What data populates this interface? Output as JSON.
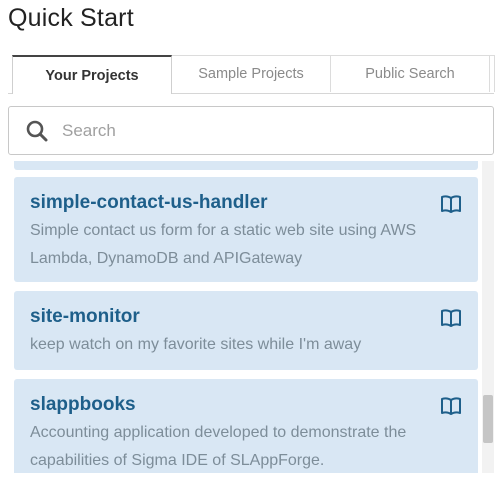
{
  "page_title": "Quick Start",
  "tabs": [
    {
      "label": "Your Projects",
      "active": true
    },
    {
      "label": "Sample Projects",
      "active": false
    },
    {
      "label": "Public Search",
      "active": false
    },
    {
      "label": "",
      "active": false
    }
  ],
  "search": {
    "placeholder": "Search",
    "value": "",
    "icon": "search-icon"
  },
  "projects": [
    {
      "name": "simple-contact-us-handler",
      "description": "Simple contact us form for a static web site using AWS Lambda, DynamoDB and APIGateway",
      "icon": "book-icon"
    },
    {
      "name": "site-monitor",
      "description": "keep watch on my favorite sites while I'm away",
      "icon": "book-icon"
    },
    {
      "name": "slappbooks",
      "description": "Accounting application developed to demonstrate the capabilities of Sigma IDE of SLAppForge.",
      "icon": "book-icon"
    }
  ],
  "colors": {
    "card_bg": "#d9e7f4",
    "title_link": "#1e5f8a",
    "desc_text": "#7d8d99",
    "active_tab_border": "#444444"
  }
}
